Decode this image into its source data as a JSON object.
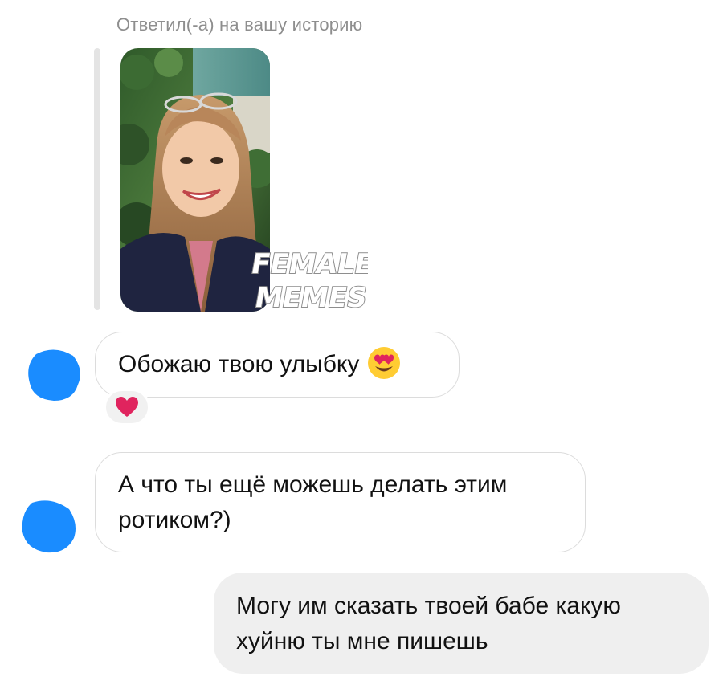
{
  "story_reply": {
    "caption": "Ответил(-а) на вашу историю",
    "watermark": {
      "line1": "FEMALE",
      "line2": "MEMES"
    }
  },
  "messages": [
    {
      "direction": "incoming",
      "lines": [
        "Обожаю твою улыбку"
      ],
      "emoji": "smiling-face-with-heart-eyes",
      "reaction": "red-heart"
    },
    {
      "direction": "incoming",
      "lines": [
        "А что ты ещё можешь делать этим",
        "ротиком?)"
      ]
    },
    {
      "direction": "outgoing",
      "lines": [
        "Могу им сказать твоей бабе какую",
        "хуйню ты мне пишешь"
      ]
    }
  ],
  "colors": {
    "incoming_bubble_border": "#dcdcdc",
    "outgoing_bubble_bg": "#efefef",
    "caption_text": "#8e8e8e",
    "avatar_blur": "#1a8cff",
    "heart": "#e0245e"
  }
}
